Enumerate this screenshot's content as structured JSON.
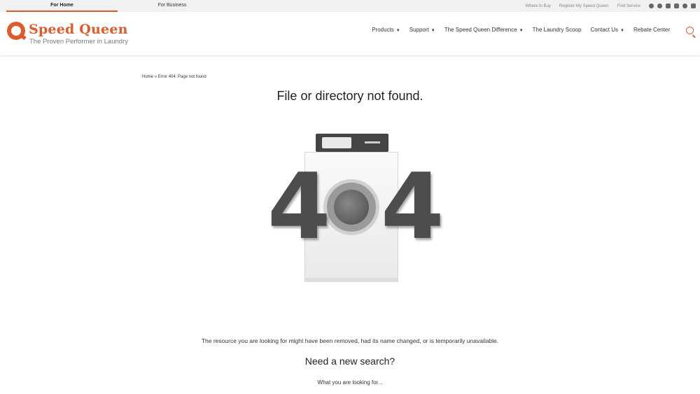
{
  "topbar": {
    "for_home": "For Home",
    "for_business": "For Business",
    "where_to_buy": "Where to Buy",
    "register": "Register My Speed Queen",
    "find_service": "Find Service",
    "social_icons": [
      "globe-icon",
      "facebook-icon",
      "youtube-icon",
      "twitter-icon",
      "instagram-icon",
      "tiktok-icon"
    ]
  },
  "header": {
    "brand": "Speed Queen",
    "tagline": "The Proven Performer in Laundry",
    "nav": [
      "Products",
      "Support",
      "The Speed Queen Difference",
      "The Laundry Scoop",
      "Contact Us",
      "Rebate Center"
    ],
    "nav_dropdown": [
      true,
      true,
      true,
      false,
      true,
      false
    ],
    "accent_color": "#e05a2b"
  },
  "breadcrumb": {
    "home": "Home",
    "sep": "»",
    "current": "Error 404: Page not found"
  },
  "main": {
    "title": "File or directory not found.",
    "digit_left": "4",
    "digit_right": "4",
    "message": "The resource you are looking for might have been removed, had its name changed, or is temporarily unavailable.",
    "subheading": "Need a new search?",
    "search_placeholder": "What you are looking for..."
  }
}
